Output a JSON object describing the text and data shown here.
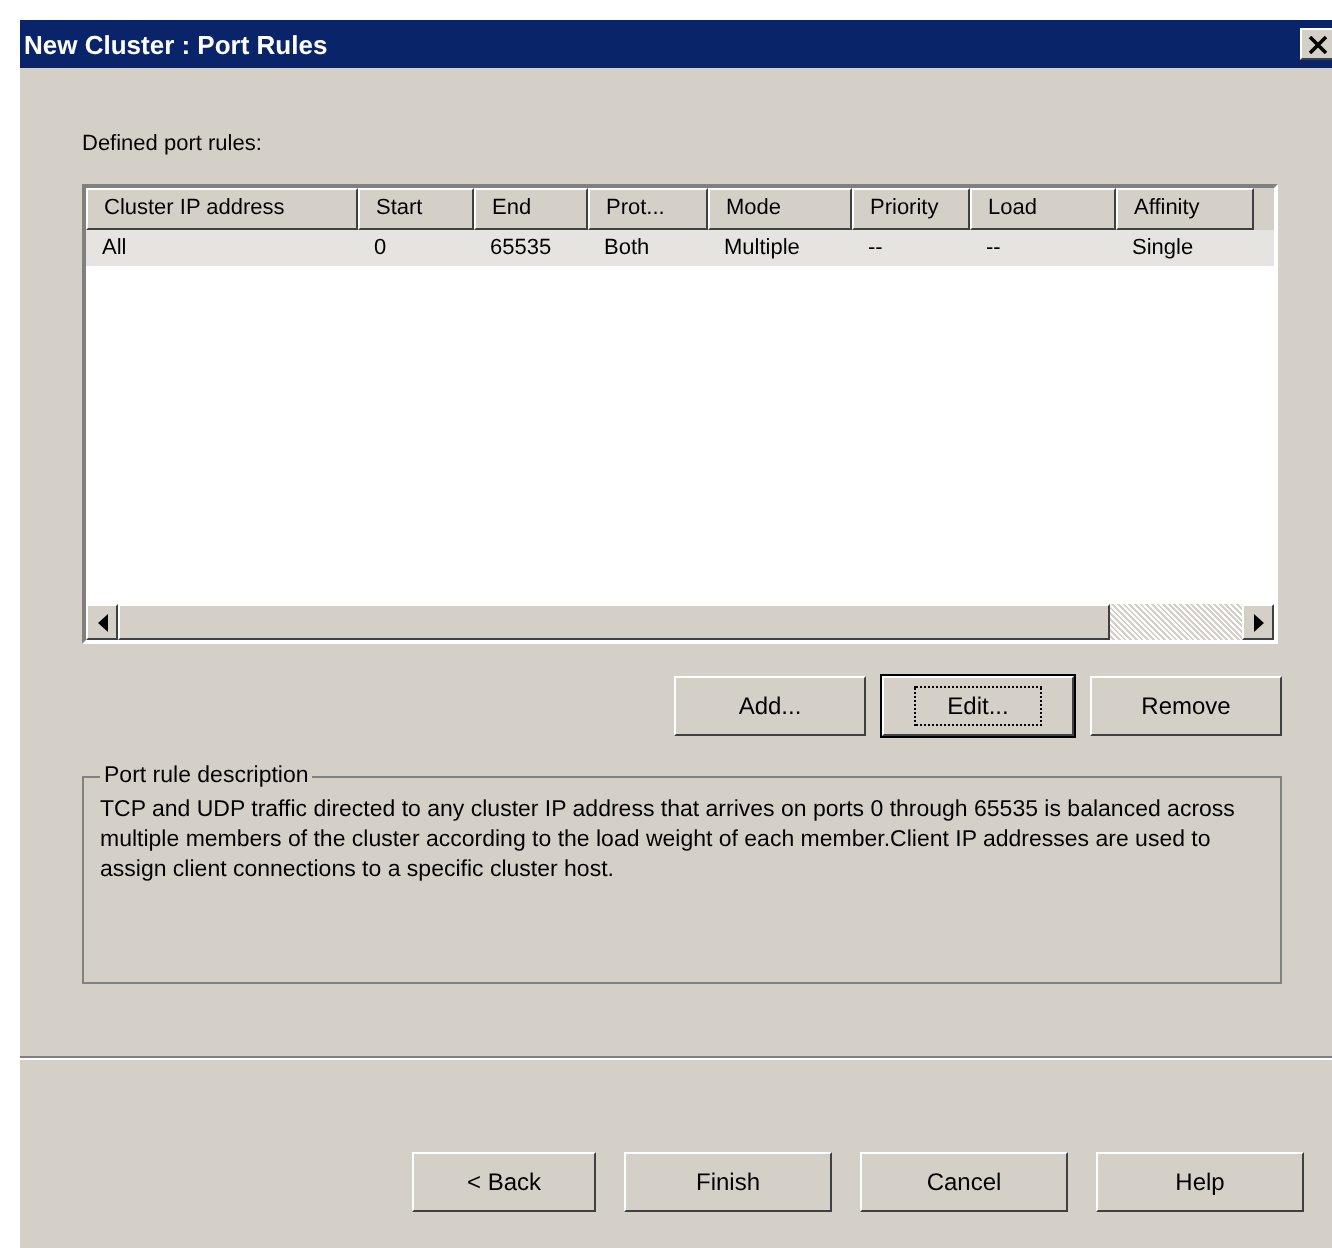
{
  "window": {
    "title": "New Cluster :  Port Rules"
  },
  "port_rules": {
    "label": "Defined port rules:",
    "columns": [
      "Cluster IP address",
      "Start",
      "End",
      "Prot...",
      "Mode",
      "Priority",
      "Load",
      "Affinity"
    ],
    "rows": [
      {
        "cells": [
          "All",
          "0",
          "65535",
          "Both",
          "Multiple",
          "--",
          "--",
          "Single"
        ],
        "selected": true
      }
    ]
  },
  "rule_buttons": [
    {
      "label": "Add...",
      "default": false
    },
    {
      "label": "Edit...",
      "default": true
    },
    {
      "label": "Remove",
      "default": false
    }
  ],
  "description": {
    "title": "Port rule description",
    "text": "TCP and UDP traffic directed to any cluster IP address that arrives on ports 0 through 65535 is balanced across multiple members of the cluster according to the load weight of each member.Client IP addresses are used to assign client connections to a specific cluster host."
  },
  "footer_buttons": [
    {
      "label": "< Back"
    },
    {
      "label": "Finish"
    },
    {
      "label": "Cancel"
    },
    {
      "label": "Help"
    }
  ]
}
